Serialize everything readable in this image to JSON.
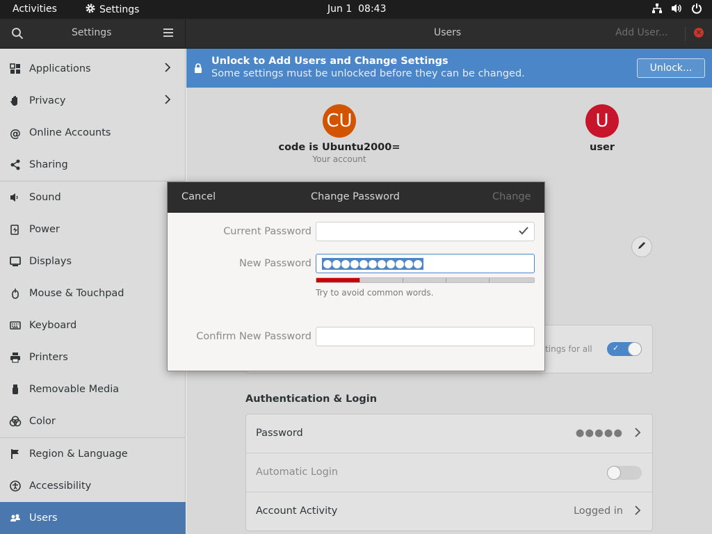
{
  "topbar": {
    "activities": "Activities",
    "app_name": "Settings",
    "date": "Jun 1",
    "time": "08:43"
  },
  "headerbar": {
    "left_title": "Settings",
    "title": "Users",
    "add_user": "Add User..."
  },
  "sidebar": {
    "items": [
      {
        "label": "Applications",
        "icon": "grid-icon",
        "chevron": true
      },
      {
        "label": "Privacy",
        "icon": "hand-icon",
        "chevron": true
      },
      {
        "label": "Online Accounts",
        "icon": "at-icon",
        "chevron": false
      },
      {
        "label": "Sharing",
        "icon": "share-icon",
        "chevron": false
      },
      {
        "label": "Sound",
        "icon": "speaker-icon",
        "chevron": false
      },
      {
        "label": "Power",
        "icon": "power-plug-icon",
        "chevron": false
      },
      {
        "label": "Displays",
        "icon": "display-icon",
        "chevron": false
      },
      {
        "label": "Mouse & Touchpad",
        "icon": "mouse-icon",
        "chevron": false
      },
      {
        "label": "Keyboard",
        "icon": "keyboard-icon",
        "chevron": false
      },
      {
        "label": "Printers",
        "icon": "printer-icon",
        "chevron": false
      },
      {
        "label": "Removable Media",
        "icon": "usb-icon",
        "chevron": false
      },
      {
        "label": "Color",
        "icon": "palette-icon",
        "chevron": false
      },
      {
        "label": "Region & Language",
        "icon": "flag-icon",
        "chevron": false
      },
      {
        "label": "Accessibility",
        "icon": "accessibility-icon",
        "chevron": false
      },
      {
        "label": "Users",
        "icon": "users-icon",
        "chevron": false,
        "active": true
      }
    ]
  },
  "banner": {
    "title": "Unlock to Add Users and Change Settings",
    "subtitle": "Some settings must be unlocked before they can be changed.",
    "unlock_button": "Unlock..."
  },
  "accounts": {
    "current": {
      "initials": "CU",
      "name": "code is Ubuntu2000=",
      "sub": "Your account",
      "color": "#d35400"
    },
    "other": {
      "initials": "U",
      "name": "user",
      "color": "#c7162b"
    }
  },
  "language_card": {
    "partial_text": "ettings for all",
    "toggle_on": true
  },
  "auth_section": {
    "title": "Authentication & Login",
    "rows": {
      "password": {
        "label": "Password",
        "value": "●●●●●"
      },
      "auto_login": {
        "label": "Automatic Login",
        "toggle_on": false
      },
      "activity": {
        "label": "Account Activity",
        "value": "Logged in"
      }
    }
  },
  "dialog": {
    "cancel": "Cancel",
    "title": "Change Password",
    "change": "Change",
    "current_label": "Current Password",
    "new_label": "New Password",
    "new_value_dots": 11,
    "strength_level": 0.2,
    "hint": "Try to avoid common words.",
    "confirm_label": "Confirm New Password"
  },
  "colors": {
    "accent": "#4a86c8",
    "sidebar_active": "#4a77ad",
    "strength_weak": "#cc0000"
  }
}
